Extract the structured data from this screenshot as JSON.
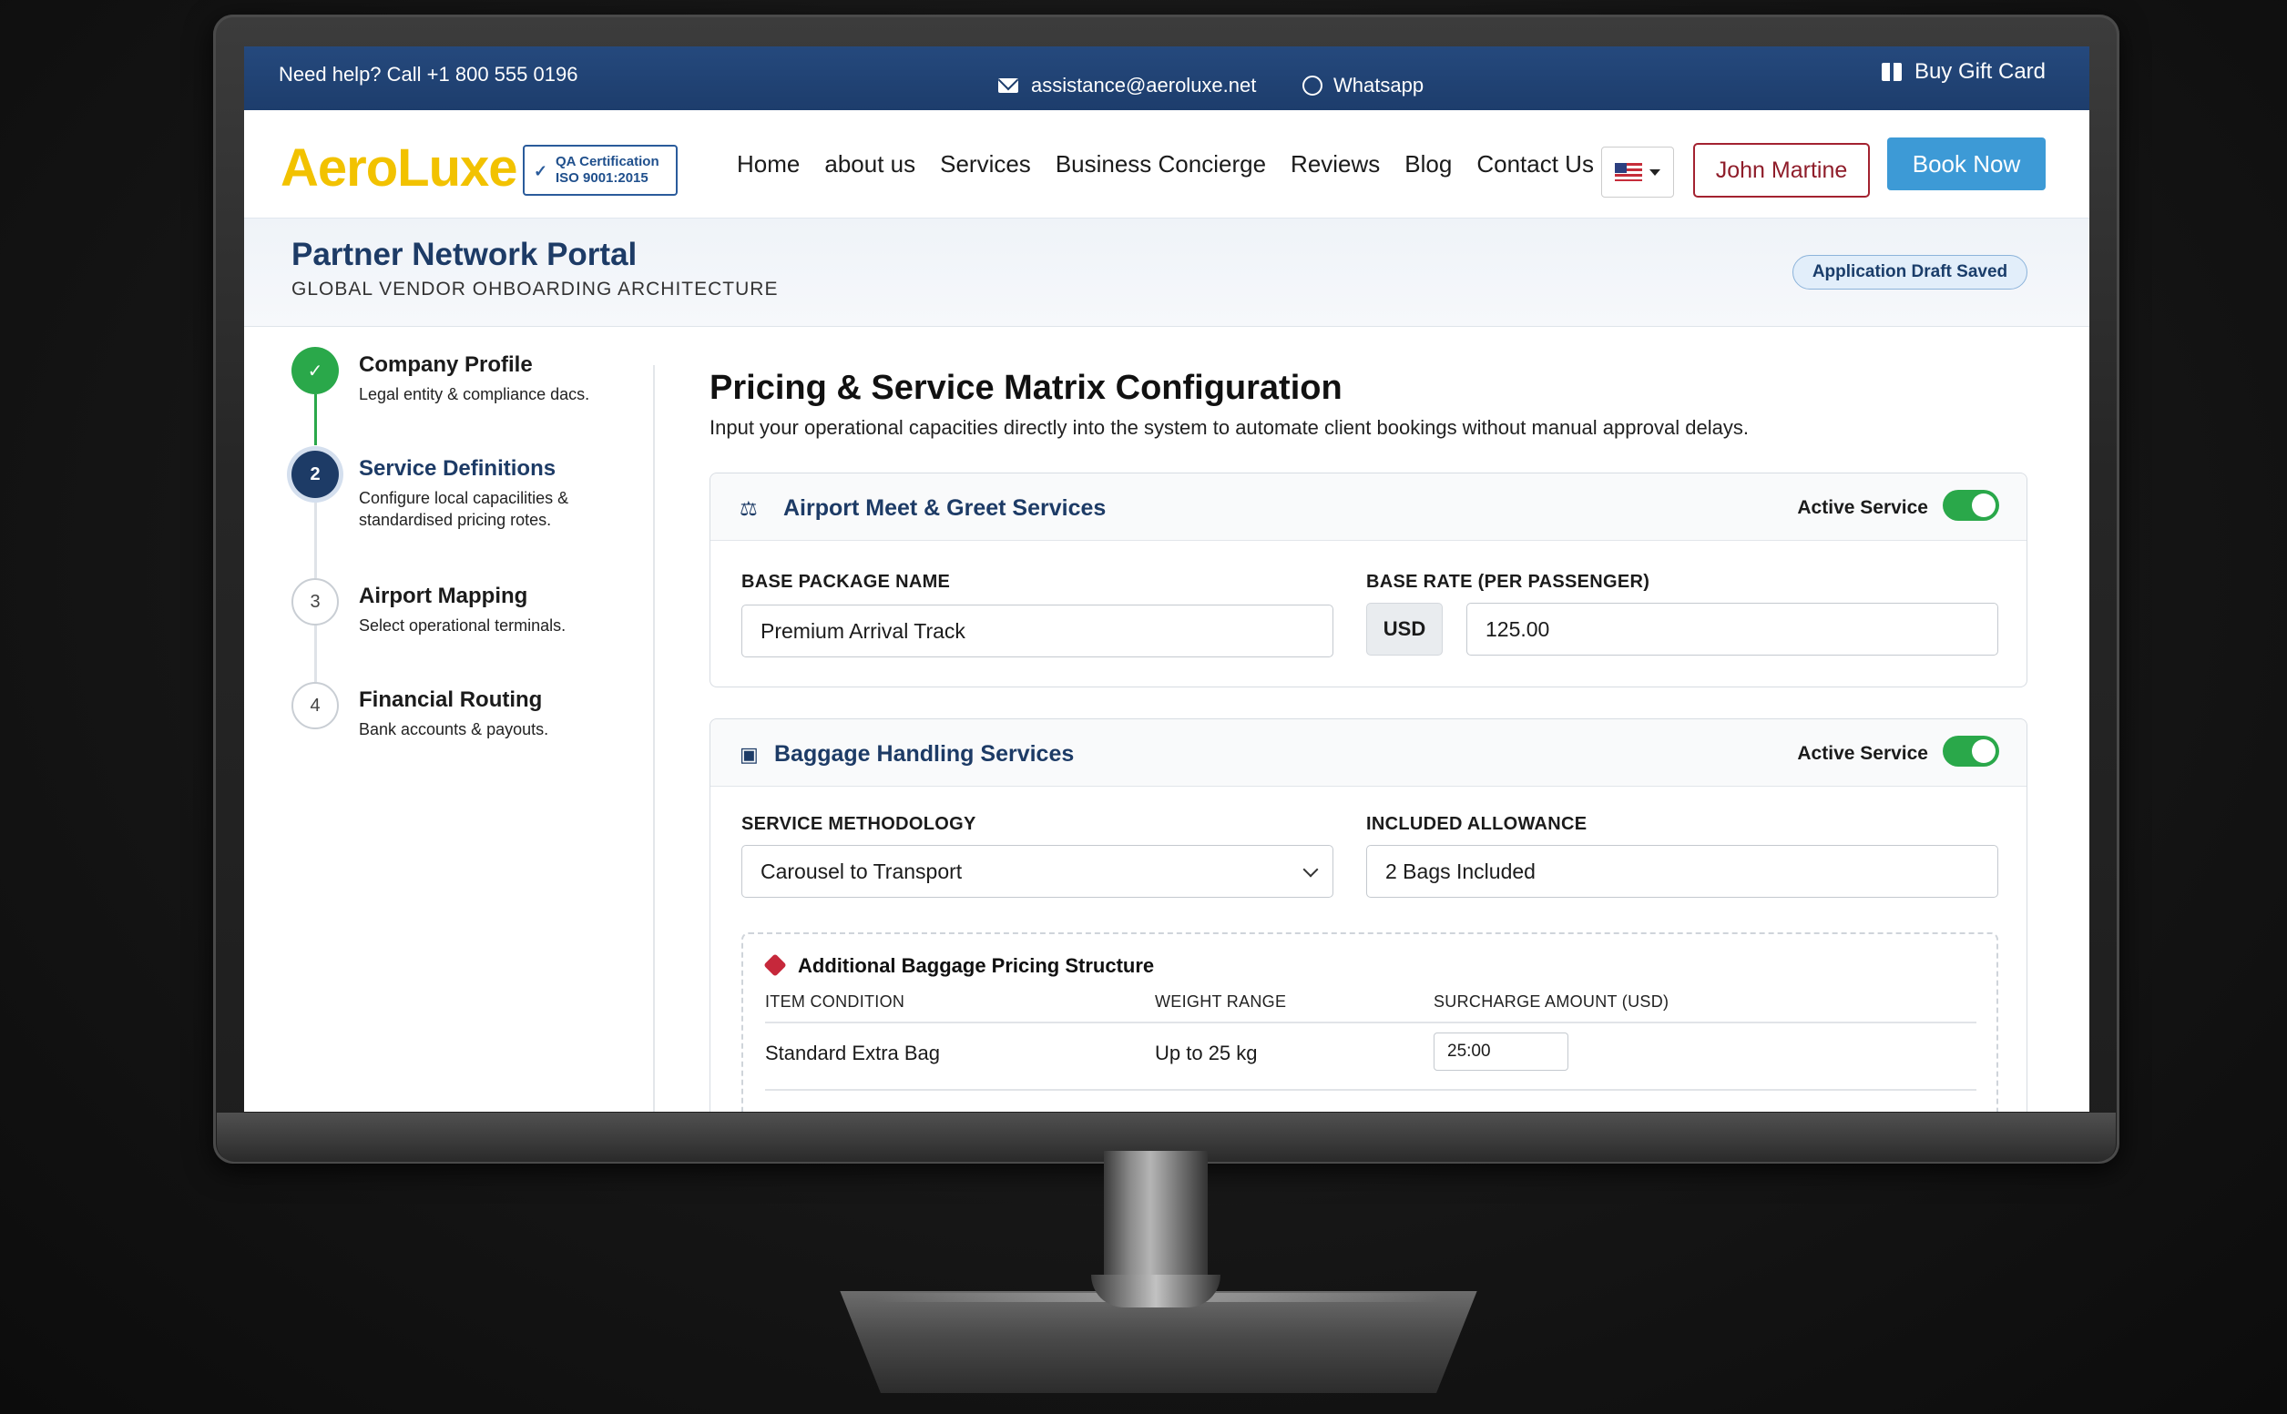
{
  "topbar": {
    "help": "Need help? Call +1 800 555 0196",
    "email": "assistance@aeroluxe.net",
    "whatsapp": "Whatsapp",
    "gift": "Buy Gift Card"
  },
  "nav": {
    "logo": "AeroLuxe",
    "cert_line1": "QA Certification",
    "cert_line2": "ISO 9001:2015",
    "items": [
      "Home",
      "about us",
      "Services",
      "Business Concierge",
      "Reviews",
      "Blog",
      "Contact Us"
    ],
    "user": "John Martine",
    "book": "Book Now"
  },
  "portal": {
    "title": "Partner Network Portal",
    "subtitle": "GLOBAL VENDOR OHBOARDING ARCHITECTURE",
    "status": "Application Draft Saved"
  },
  "steps": [
    {
      "num": "✓",
      "title": "Company Profile",
      "desc": "Legal entity & compliance dacs."
    },
    {
      "num": "2",
      "title": "Service Definitions",
      "desc": "Configure local capacilities & standardised pricing rotes."
    },
    {
      "num": "3",
      "title": "Airport Mapping",
      "desc": "Select operational terminals."
    },
    {
      "num": "4",
      "title": "Financial Routing",
      "desc": "Bank accounts & payouts."
    }
  ],
  "main": {
    "title": "Pricing & Service Matrix Configuration",
    "subtitle": "Input your operational capacities directly into the system to automate client bookings without manual approval delays."
  },
  "card1": {
    "title": "Airport Meet & Greet Services",
    "active_label": "Active Service",
    "pkg_label": "BASE PACKAGE NAME",
    "pkg_value": "Premium Arrival Track",
    "rate_label": "BASE RATE (PER PASSENGER)",
    "currency": "USD",
    "rate_value": "125.00"
  },
  "card2": {
    "title": "Baggage Handling Services",
    "active_label": "Active Service",
    "method_label": "SERVICE METHODOLOGY",
    "method_value": "Carousel to Transport",
    "allow_label": "INCLUDED ALLOWANCE",
    "allow_value": "2 Bags Included",
    "sub_title": "Additional Baggage Pricing Structure",
    "columns": [
      "ITEM CONDITION",
      "WEIGHT RANGE",
      "SURCHARGE AMOUNT (USD)"
    ],
    "rows": [
      {
        "condition": "Standard Extra Bag",
        "weight": "Up to 25 kg",
        "surcharge": "25:00"
      }
    ]
  },
  "colors": {
    "brand_navy": "#1d3b66",
    "topbar_blue": "#25497d",
    "logo_yellow": "#f2c200",
    "accent_blue": "#3d9ad6",
    "success_green": "#2aa84a",
    "user_red": "#a32230"
  }
}
